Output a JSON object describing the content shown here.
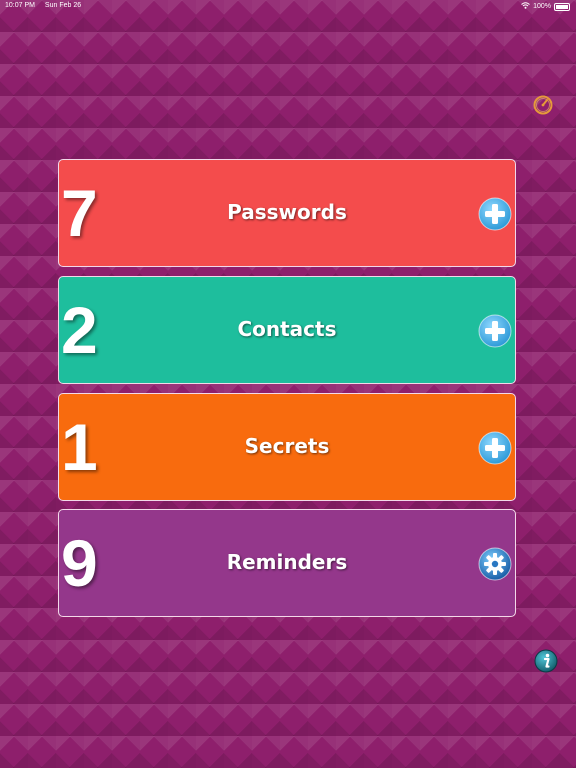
{
  "status_bar": {
    "time": "10:07 PM",
    "date": "Sun Feb 26",
    "battery": "100%"
  },
  "colors": {
    "background": "#8e1f6c",
    "passwords": "#f44c4c",
    "contacts": "#1ebe9d",
    "secrets": "#f86b0e",
    "reminders": "#94378b",
    "plus_button": "#4ab9ec"
  },
  "cards": {
    "passwords": {
      "count": "7",
      "title": "Passwords",
      "action_icon": "plus-icon"
    },
    "contacts": {
      "count": "2",
      "title": "Contacts",
      "action_icon": "plus-icon"
    },
    "secrets": {
      "count": "1",
      "title": "Secrets",
      "action_icon": "plus-icon"
    },
    "reminders": {
      "count": "9",
      "title": "Reminders",
      "action_icon": "gear-icon"
    }
  },
  "icons": {
    "top_right": "timer-icon",
    "bottom_right": "info-icon"
  }
}
